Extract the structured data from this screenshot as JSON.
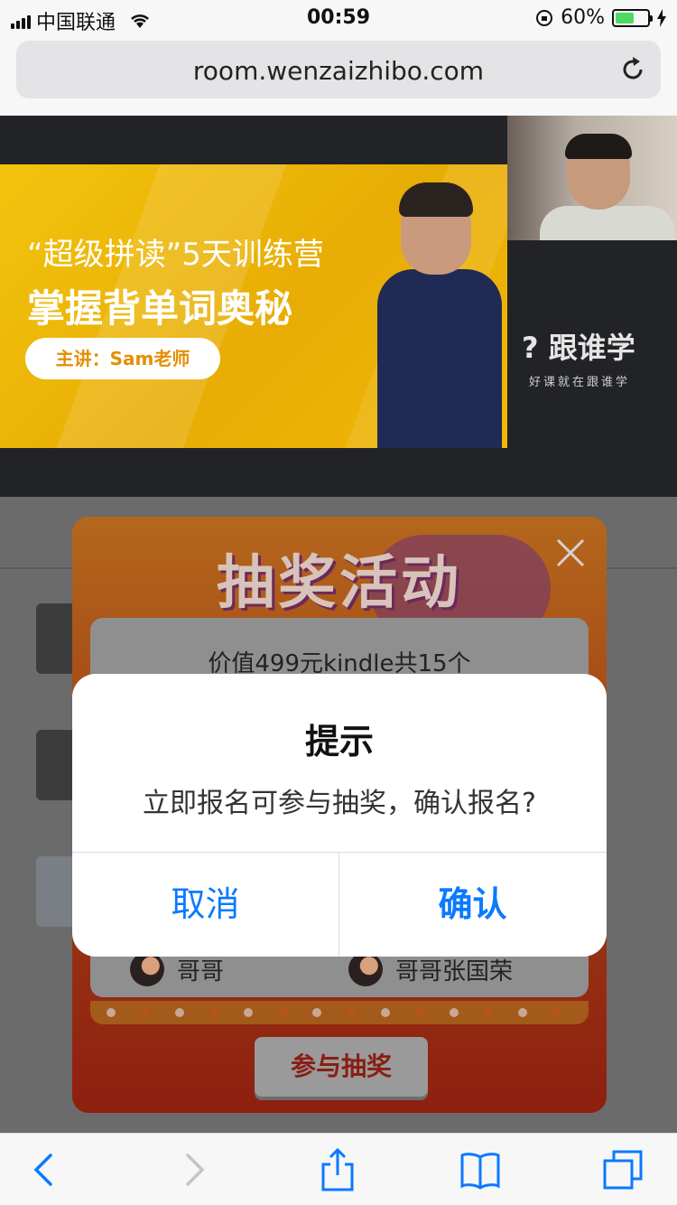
{
  "status_bar": {
    "carrier": "中国联通",
    "time": "00:59",
    "battery_percent": "60%",
    "battery_level": 0.6,
    "icons": [
      "signal-icon",
      "wifi-icon",
      "orientation-lock-icon",
      "battery-icon",
      "charging-icon"
    ]
  },
  "browser": {
    "url": "room.wenzaizhibo.com",
    "reload_icon": "reload-icon"
  },
  "video": {
    "banner_subtitle": "“超级拼读”5天训练营",
    "banner_title": "掌握背单词奥秘",
    "banner_speaker": "主讲：Sam老师",
    "brand_name": "跟谁学",
    "brand_slogan": "好课就在跟谁学"
  },
  "lottery": {
    "title": "抽奖活动",
    "prize": "价值499元kindle共15个",
    "winners": [
      {
        "name": "哥哥"
      },
      {
        "name": "哥哥张国荣"
      }
    ],
    "join_button": "参与抽奖",
    "close_icon": "close-icon"
  },
  "alert": {
    "title": "提示",
    "message": "立即报名可参与抽奖，确认报名?",
    "cancel": "取消",
    "confirm": "确认",
    "accent_color": "#0a7aff"
  },
  "toolbar": {
    "icons": [
      "back-icon",
      "forward-icon",
      "share-icon",
      "bookmarks-icon",
      "tabs-icon"
    ]
  }
}
